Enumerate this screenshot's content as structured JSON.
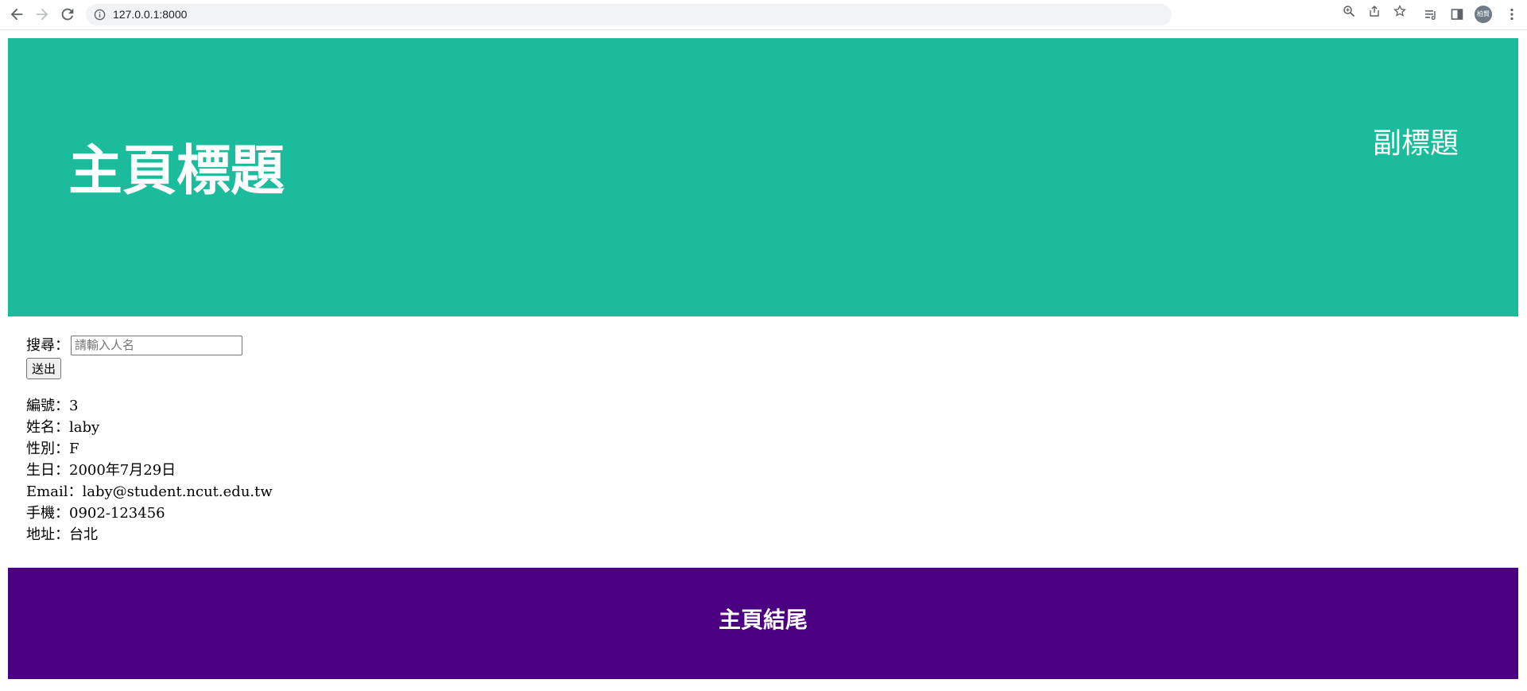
{
  "browser": {
    "url": "127.0.0.1:8000",
    "avatar_text": "柏賢"
  },
  "header": {
    "title": "主頁標題",
    "subtitle": "副標題"
  },
  "search": {
    "label": "搜尋：",
    "placeholder": "請輸入人名",
    "submit_label": "送出"
  },
  "record": {
    "id_label": "編號：",
    "id": "3",
    "name_label": "姓名：",
    "name": "laby",
    "gender_label": "性別：",
    "gender": "F",
    "birthday_label": "生日：",
    "birthday": "2000年7月29日",
    "email_label": "Email：",
    "email": "laby@student.ncut.edu.tw",
    "phone_label": "手機：",
    "phone": "0902-123456",
    "address_label": "地址：",
    "address": "台北"
  },
  "footer": {
    "text": "主頁結尾"
  },
  "colors": {
    "header_bg": "#1abc9c",
    "footer_bg": "#4b0082"
  }
}
